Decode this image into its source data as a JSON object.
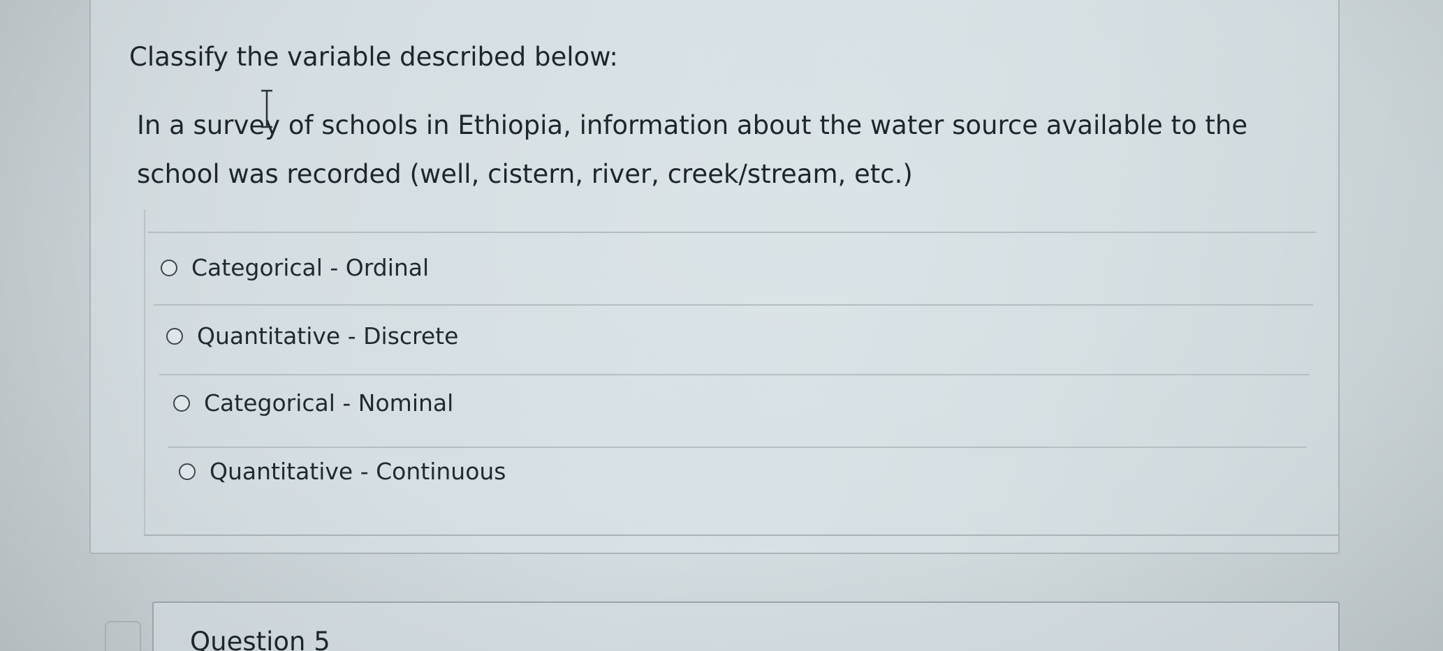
{
  "question": {
    "title": "Classify the variable described below:",
    "body": "In a survey of schools in Ethiopia, information about the water source available to the school was recorded (well, cistern, river, creek/stream, etc.)",
    "options": [
      {
        "label": "Categorical - Ordinal",
        "selected": false
      },
      {
        "label": "Quantitative - Discrete",
        "selected": false
      },
      {
        "label": "Categorical - Nominal",
        "selected": false
      },
      {
        "label": "Quantitative - Continuous",
        "selected": false
      }
    ]
  },
  "next_question": {
    "title": "Question 5"
  },
  "colors": {
    "background": "#cfd8dc",
    "text": "#1c262c",
    "border": "#aab4b8"
  }
}
